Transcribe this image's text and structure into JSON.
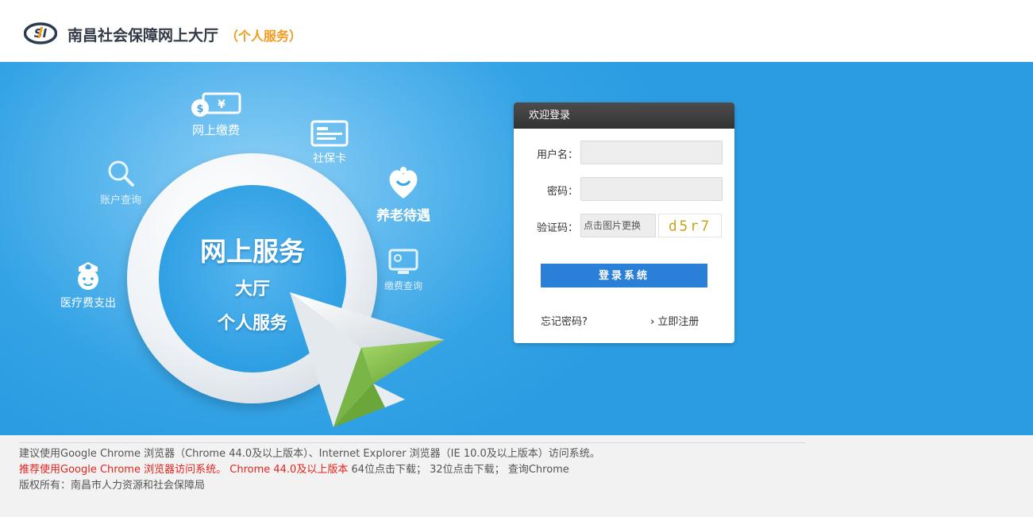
{
  "header": {
    "title": "南昌社会保障网上大厅",
    "subtitle": "（个人服务）",
    "logo_text": "SI"
  },
  "hero": {
    "center_title": "网上服务",
    "center_line2": "大厅",
    "center_line3": "个人服务",
    "features": {
      "payment": "网上缴费",
      "social_card": "社保卡",
      "account_query": "账户查询",
      "pension": "养老待遇",
      "payment_query": "缴费查询",
      "medical": "医疗费支出"
    }
  },
  "login": {
    "header": "欢迎登录",
    "username_label": "用户名：",
    "username_value": "",
    "password_label": "密码：",
    "password_value": "",
    "captcha_label": "验证码：",
    "captcha_placeholder": "点击图片更换",
    "captcha_text": "d5r7",
    "submit_label": "登录系统",
    "forgot_label": "忘记密码?",
    "register_label": "立即注册"
  },
  "footer": {
    "line1": "建议使用Google Chrome 浏览器（Chrome 44.0及以上版本）、Internet Explorer 浏览器（IE 10.0及以上版本）访问系统。",
    "line2_red1": "推荐使用Google Chrome 浏览器访问系统。",
    "line2_red2": "Chrome 44.0及以上版本",
    "line2_gray": "64位点击下载； 32位点击下载； 查询Chrome",
    "line3": "版权所有：南昌市人力资源和社会保障局"
  },
  "colors": {
    "accent_blue": "#2a7fd6",
    "hero_blue": "#34a3e5",
    "subtitle_orange": "#f39a1d",
    "notice_red": "#e5231d"
  }
}
